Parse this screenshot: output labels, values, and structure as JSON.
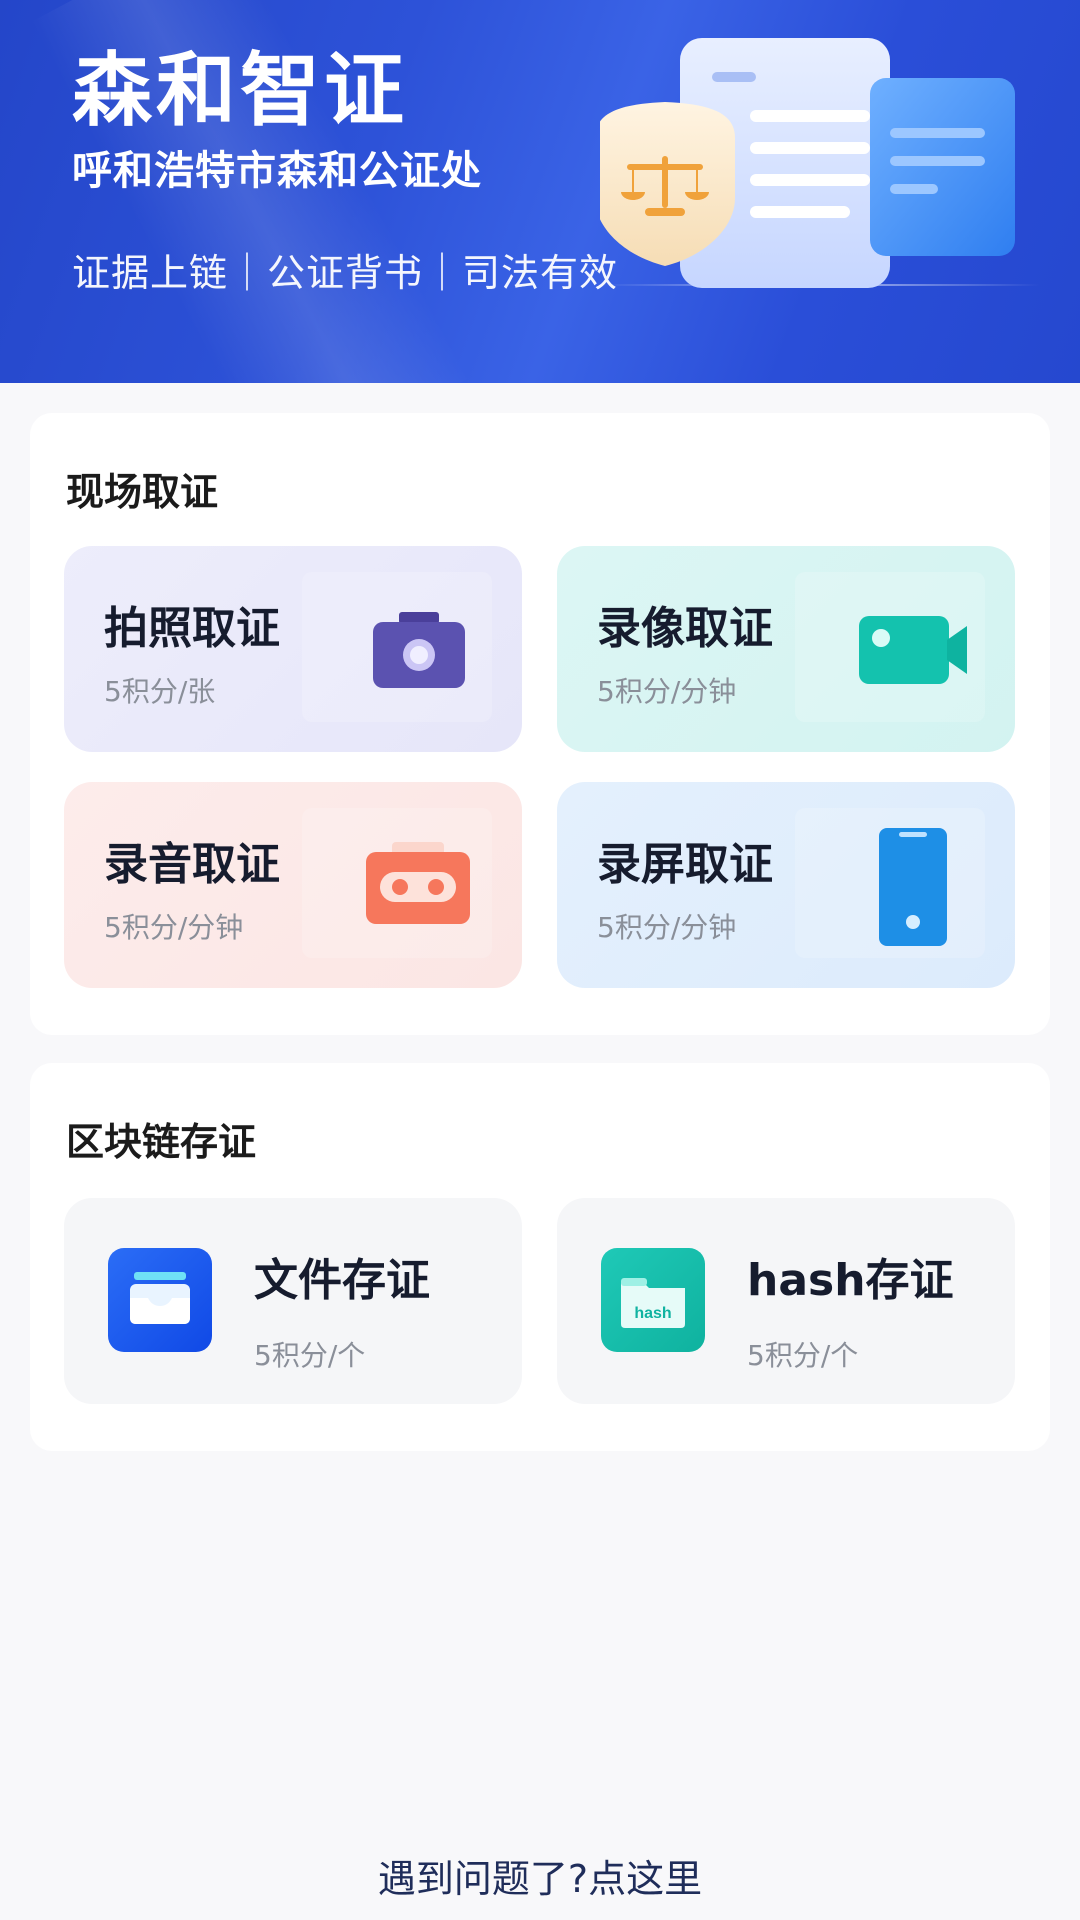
{
  "banner": {
    "title": "森和智证",
    "subtitle": "呼和浩特市森和公证处",
    "slogan": "证据上链｜公证背书｜司法有效"
  },
  "onsite": {
    "title": "现场取证",
    "tiles": [
      {
        "name": "拍照取证",
        "price": "5积分/张",
        "icon": "camera-icon"
      },
      {
        "name": "录像取证",
        "price": "5积分/分钟",
        "icon": "video-camera-icon"
      },
      {
        "name": "录音取证",
        "price": "5积分/分钟",
        "icon": "cassette-icon"
      },
      {
        "name": "录屏取证",
        "price": "5积分/分钟",
        "icon": "phone-icon"
      }
    ]
  },
  "blockchain": {
    "title": "区块链存证",
    "tiles": [
      {
        "name": "文件存证",
        "price": "5积分/个",
        "icon": "file-tray-icon"
      },
      {
        "name": "hash存证",
        "price": "5积分/个",
        "icon": "hash-folder-icon",
        "icon_label": "hash"
      }
    ]
  },
  "footer": {
    "help_text": "遇到问题了?点这里"
  },
  "colors": {
    "banner": "#2d52d8",
    "photo_tile": "#ececfb",
    "video_tile": "#d9f5f3",
    "audio_tile": "#fce9e8",
    "screen_tile": "#e1eefd",
    "photo_icon": "#5b52b0",
    "video_icon": "#12c1ad",
    "audio_icon": "#f5735a",
    "screen_icon": "#1e8fe6",
    "file_icon": "#1f5cf0",
    "hash_icon": "#18c3b0"
  }
}
